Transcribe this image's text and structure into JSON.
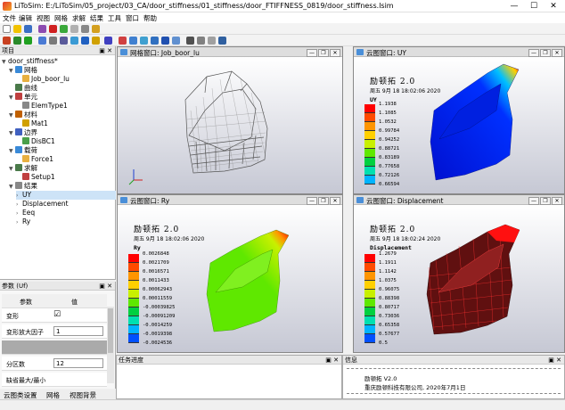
{
  "window": {
    "title": "LiToSim: E:/LiToSim/05_project/03_CA/door_stiffness/01_stiffness/door_FTIFFNESS_0819/door_stiffness.lsim",
    "min": "—",
    "max": "☐",
    "close": "✕"
  },
  "menu": [
    "文件",
    "编辑",
    "视图",
    "网格",
    "求解",
    "结果",
    "工具",
    "窗口",
    "帮助"
  ],
  "tree": {
    "header": "项目",
    "header_buttons": "▣ ✕",
    "root": "door_stiffness*",
    "nodes": [
      {
        "label": "网格",
        "indent": 1,
        "expanded": true
      },
      {
        "label": "Job_boor_lu",
        "indent": 2
      },
      {
        "label": "曲线",
        "indent": 1
      },
      {
        "label": "单元",
        "indent": 1,
        "expanded": true
      },
      {
        "label": "ElemType1",
        "indent": 2
      },
      {
        "label": "材料",
        "indent": 1,
        "expanded": true
      },
      {
        "label": "Mat1",
        "indent": 2
      },
      {
        "label": "边界",
        "indent": 1,
        "expanded": true
      },
      {
        "label": "DisBC1",
        "indent": 2
      },
      {
        "label": "载荷",
        "indent": 1,
        "expanded": true
      },
      {
        "label": "Force1",
        "indent": 2
      },
      {
        "label": "求解",
        "indent": 1,
        "expanded": true
      },
      {
        "label": "Setup1",
        "indent": 2
      },
      {
        "label": "结果",
        "indent": 1,
        "expanded": true
      },
      {
        "label": "UY",
        "indent": 2,
        "selected": true
      },
      {
        "label": "Displacement",
        "indent": 2
      },
      {
        "label": "Eeq",
        "indent": 2
      },
      {
        "label": "Ry",
        "indent": 2
      }
    ]
  },
  "props": {
    "header": "参数 (Uf)",
    "header_buttons": "▣ ✕",
    "col_param": "参数",
    "col_value": "值",
    "rows": [
      {
        "label": "变形",
        "value": "☑",
        "type": "check"
      },
      {
        "label": "变形放大因子",
        "value": "1",
        "type": "input"
      },
      {
        "label": "",
        "value": "",
        "type": "gray"
      },
      {
        "label": "分区数",
        "value": "12",
        "type": "input"
      },
      {
        "label": "缺省最大/最小",
        "value": "",
        "type": "check"
      }
    ]
  },
  "bottom_tabs": [
    "云图类设置",
    "网格",
    "视图背景"
  ],
  "views": [
    {
      "title": "网格窗口: Job_boor_lu"
    },
    {
      "title": "云图窗口: UY",
      "app": "励顿拓 2.0",
      "date": "周五 9月 18 18:02:06 2020",
      "var": "UY",
      "legend": [
        "1.1938",
        "1.1085",
        "1.0532",
        "0.99784",
        "0.94252",
        "0.88721",
        "0.83189",
        "0.77658",
        "0.72126",
        "0.66594"
      ]
    },
    {
      "title": "云图窗口: Ry",
      "app": "励顿拓 2.0",
      "date": "周五 9月 18 18:02:06 2020",
      "var": "Ry",
      "legend": [
        "0.0026848",
        "0.0021709",
        "0.0016571",
        "0.0011433",
        "0.00062943",
        "0.00011559",
        "-0.00039825",
        "-0.00091209",
        "-0.0014259",
        "-0.0019398",
        "-0.0024536"
      ]
    },
    {
      "title": "云图窗口: Displacement",
      "app": "励顿拓 2.0",
      "date": "周五 9月 18 18:02:24 2020",
      "var": "Displacement",
      "legend": [
        "1.2679",
        "1.1911",
        "1.1142",
        "1.0375",
        "0.96075",
        "0.88398",
        "0.80717",
        "0.73036",
        "0.65358",
        "0.57677",
        "0.5"
      ]
    }
  ],
  "panels": {
    "task": "任务进度",
    "info": "信息",
    "task_buttons": "▣ ✕",
    "info_buttons": "▣ ✕"
  },
  "info_lines": [
    "励顿拓 V2.0",
    "重庆励顿科技有限公司, 2020年7月1日"
  ],
  "colors": {
    "legend": [
      "#ff0000",
      "#ff4a00",
      "#ff9500",
      "#ffd000",
      "#c8f000",
      "#5fe800",
      "#00d040",
      "#00e0b0",
      "#00b4ff",
      "#0050ff",
      "#0010d0"
    ]
  }
}
